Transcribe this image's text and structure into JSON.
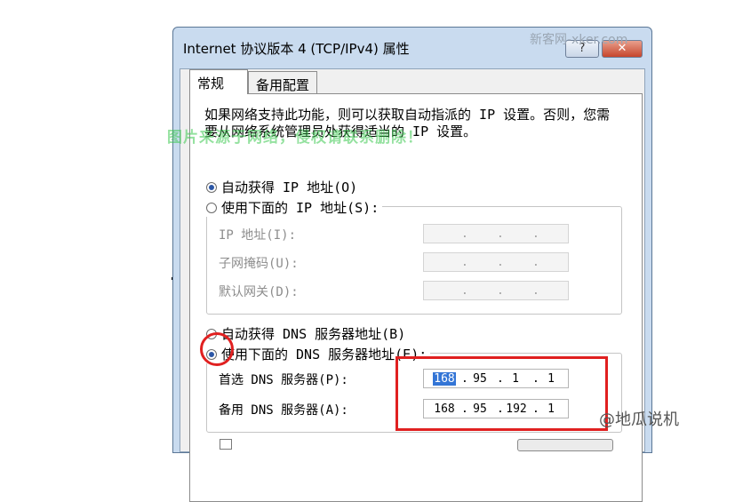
{
  "window": {
    "title": "Internet 协议版本 4 (TCP/IPv4) 属性",
    "help_label": "?",
    "close_label": "✕"
  },
  "tabs": [
    {
      "label": "常规"
    },
    {
      "label": "备用配置"
    }
  ],
  "description": "如果网络支持此功能，则可以获取自动指派的 IP 设置。否则，您需要从网络系统管理员处获得适当的 IP 设置。",
  "overlay_watermark": "图片来源于网络，侵权请联系删除！",
  "ip": {
    "auto_label": "自动获得 IP 地址(O)",
    "auto_selected": true,
    "manual_label": "使用下面的 IP 地址(S):",
    "manual_selected": false,
    "fields": [
      {
        "label": "IP 地址(I):",
        "value": [
          "",
          "",
          "",
          ""
        ]
      },
      {
        "label": "子网掩码(U):",
        "value": [
          "",
          "",
          "",
          ""
        ]
      },
      {
        "label": "默认网关(D):",
        "value": [
          "",
          "",
          "",
          ""
        ]
      }
    ]
  },
  "dns": {
    "auto_label": "自动获得 DNS 服务器地址(B)",
    "auto_selected": false,
    "manual_label": "使用下面的 DNS 服务器地址(E):",
    "manual_selected": true,
    "preferred": {
      "label": "首选 DNS 服务器(P):",
      "octets": [
        "168",
        "95",
        "1",
        "1"
      ]
    },
    "alternate": {
      "label": "备用 DNS 服务器(A):",
      "octets": [
        "168",
        "95",
        "192",
        "1"
      ]
    }
  },
  "watermarks": {
    "corner": "新客网-xker.com",
    "bottom": "@地瓜说机"
  },
  "colors": {
    "highlight_box": "#e02020",
    "selection": "#3375d6",
    "title_bar": "#c9dbef"
  }
}
